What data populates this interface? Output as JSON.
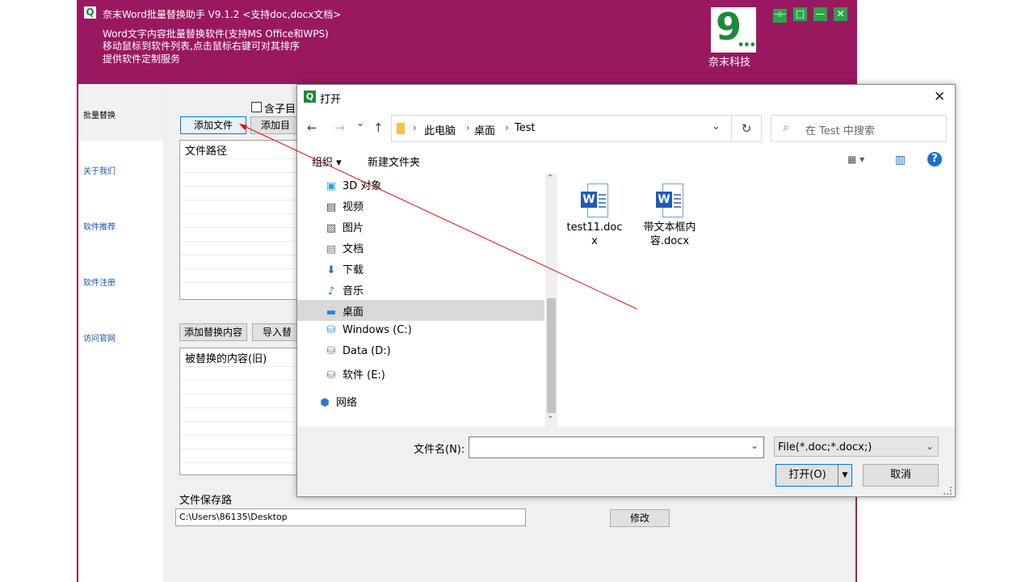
{
  "app": {
    "title": "奈末Word批量替换助手   V9.1.2  <支持doc,docx文档>",
    "logo_letter": "Q",
    "desc_lines": [
      "Word文字内容批量替换软件(支持MS Office和WPS)",
      "移动鼠标到软件列表,点击鼠标右键可对其排序",
      "提供软件定制服务"
    ],
    "brand_name": "奈末科技",
    "brand_logo_text": "9",
    "brand_logo_dots": "•••",
    "window_controls": [
      "⊣⊢",
      "□",
      "—",
      "✕"
    ]
  },
  "sidebar": {
    "items": [
      {
        "label": "批量替换"
      },
      {
        "label": "关于我们"
      },
      {
        "label": "软件推荐"
      },
      {
        "label": "软件注册"
      },
      {
        "label": "访问官网"
      }
    ]
  },
  "main": {
    "checkbox_label": "含子目",
    "add_file": "添加文件",
    "add_dir": "添加目",
    "file_list_header": "文件路径",
    "add_replace": "添加替换内容",
    "import_replace": "导入替",
    "replace_list_header": "被替换的内容(旧)",
    "save_path_label": "文件保存路",
    "save_path_value": "C:\\Users\\86135\\Desktop",
    "modify": "修改"
  },
  "dialog": {
    "icon_letter": "Q",
    "title": "打开",
    "close": "✕",
    "nav": {
      "back": "←",
      "forward": "→",
      "recent": "⌄",
      "up": "↑",
      "refresh": "↻"
    },
    "breadcrumbs": [
      "此电脑",
      "桌面",
      "Test"
    ],
    "breadcrumb_sep": "›",
    "addr_dropdown": "⌄",
    "search_placeholder": "在 Test 中搜索",
    "search_icon": "⌕",
    "organize": "组织 ▾",
    "new_folder": "新建文件夹",
    "view_icon": "▦ ▾",
    "pane_icon": "▥",
    "help": "?",
    "nav_items": [
      {
        "label": "3D 对象",
        "icon": "▣"
      },
      {
        "label": "视频",
        "icon": "▤"
      },
      {
        "label": "图片",
        "icon": "▨"
      },
      {
        "label": "文档",
        "icon": "▤"
      },
      {
        "label": "下载",
        "icon": "⬇"
      },
      {
        "label": "音乐",
        "icon": "♪"
      },
      {
        "label": "桌面",
        "icon": "▬"
      },
      {
        "label": "Windows (C:)",
        "icon": "⛁"
      },
      {
        "label": "Data (D:)",
        "icon": "⛁"
      },
      {
        "label": "软件 (E:)",
        "icon": "⛁"
      },
      {
        "label": "网络",
        "icon": "⬢"
      }
    ],
    "scroll_up": "⌃",
    "scroll_down": "⌄",
    "files": [
      {
        "name_line1": "test11.doc",
        "name_line2": "x",
        "icon_letter": "W"
      },
      {
        "name_line1": "带文本框内",
        "name_line2": "容.docx",
        "icon_letter": "W"
      }
    ],
    "filename_label": "文件名(N):",
    "filename_value": "",
    "filetype": "File(*.doc;*.docx;)",
    "filetype_arrow": "⌄",
    "filename_arrow": "⌄",
    "open_btn": "打开(O)",
    "open_drop": "▼",
    "cancel_btn": "取消"
  },
  "colors": {
    "app_bg": "#9a1860",
    "accent_green": "#1c8a3a",
    "link_blue": "#1a54b0",
    "annotation_red": "#e01010"
  }
}
